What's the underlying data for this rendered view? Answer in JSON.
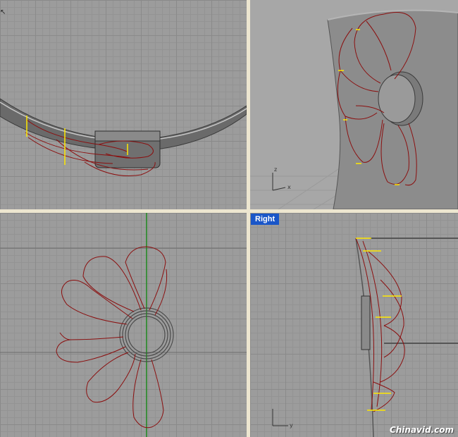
{
  "viewports": {
    "top": {
      "name": ""
    },
    "perspective": {
      "name": "",
      "axis_z": "z",
      "axis_x": "x"
    },
    "front": {
      "name": ""
    },
    "right": {
      "name": "Right",
      "axis_y": "y"
    }
  },
  "watermark": "Chinavid.com",
  "colors": {
    "grid_background": "#9c9c9c",
    "curve": "#8b0f0f",
    "highlight": "#ffe800",
    "axis_green": "#1f8a1f",
    "label_bg": "#1a56c8"
  }
}
